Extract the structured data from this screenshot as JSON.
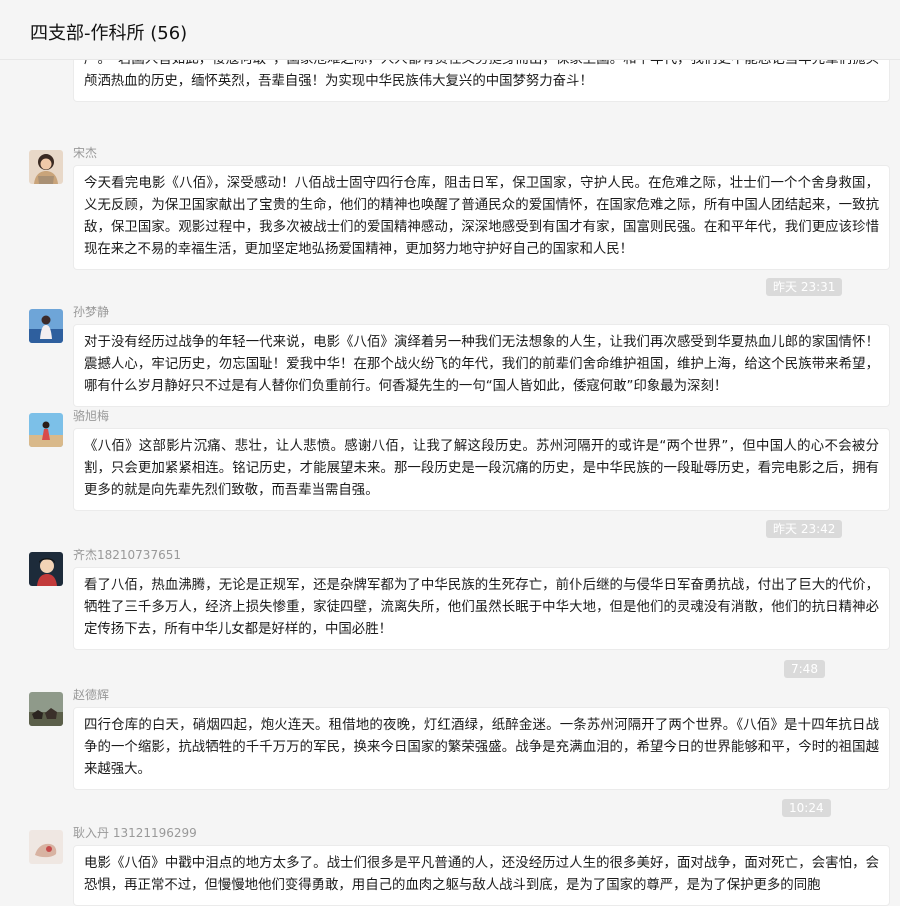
{
  "chat": {
    "title": "四支部-作科所 (56)"
  },
  "messages": [
    {
      "sender": "",
      "text": "在那些战火纷飞的年代，我观看了电影《八佰》。影片中的故事，壮烈热血主题，面对敌人的围剿进攻，八百名士兵们以一敌百，始终坚守着四行仓库，他们用身躯阻挡敌人的进攻，用生命升起旗帜，让世人看到中华儿女的自强不息，他们以血荐轩辕，捍卫了民族尊严。“若国人皆如此，倭寇何敢”，国家危难之际，人人都有责任义务挺身而出，保家卫国。和平年代，我们更不能忘记当年先辈们抛头颅洒热血的历史，缅怀英烈，吾辈自强！为实现中华民族伟大复兴的中国梦努力奋斗！"
    },
    {
      "sender": "宋杰",
      "text": "今天看完电影《八佰》，深受感动！八佰战士固守四行仓库，阻击日军，保卫国家，守护人民。在危难之际，壮士们一个个舍身救国，义无反顾，为保卫国家献出了宝贵的生命，他们的精神也唤醒了普通民众的爱国情怀，在国家危难之际，所有中国人团结起来，一致抗敌，保卫国家。观影过程中，我多次被战士们的爱国精神感动，深深地感受到有国才有家，国富则民强。在和平年代，我们更应该珍惜现在来之不易的幸福生活，更加坚定地弘扬爱国精神，更加努力地守护好自己的国家和人民！"
    },
    {
      "time": "昨天 23:31"
    },
    {
      "sender": "孙梦静",
      "text": "对于没有经历过战争的年轻一代来说，电影《八佰》演绎着另一种我们无法想象的人生，让我们再次感受到华夏热血儿郎的家国情怀！震撼人心，牢记历史，勿忘国耻！爱我中华！在那个战火纷飞的年代，我们的前辈们舍命维护祖国，维护上海，给这个民族带来希望，哪有什么岁月静好只不过是有人替你们负重前行。何香凝先生的一句“国人皆如此，倭寇何敢”印象最为深刻！"
    },
    {
      "sender": "骆旭梅",
      "text": "《八佰》这部影片沉痛、悲壮，让人悲愤。感谢八佰，让我了解这段历史。苏州河隔开的或许是“两个世界”，但中国人的心不会被分割，只会更加紧紧相连。铭记历史，才能展望未来。那一段历史是一段沉痛的历史，是中华民族的一段耻辱历史，看完电影之后，拥有更多的就是向先辈先烈们致敬，而吾辈当需自强。"
    },
    {
      "time": "昨天 23:42"
    },
    {
      "sender": "齐杰18210737651",
      "text": "看了八佰，热血沸腾，无论是正规军，还是杂牌军都为了中华民族的生死存亡，前仆后继的与侵华日军奋勇抗战，付出了巨大的代价，牺牲了三千多万人，经济上损失惨重，家徒四壁，流离失所，他们虽然长眠于中华大地，但是他们的灵魂没有消散，他们的抗日精神必定传扬下去，所有中华儿女都是好样的，中国必胜！"
    },
    {
      "time": "7:48"
    },
    {
      "sender": "赵德辉",
      "text": "四行仓库的白天，硝烟四起，炮火连天。租借地的夜晚，灯红酒绿，纸醉金迷。一条苏州河隔开了两个世界。《八佰》是十四年抗日战争的一个缩影，抗战牺牲的千千万万的军民，换来今日国家的繁荣强盛。战争是充满血泪的，希望今日的世界能够和平，今时的祖国越来越强大。"
    },
    {
      "time": "10:24"
    },
    {
      "sender": "耿入丹 13121196299",
      "text": "电影《八佰》中戳中泪点的地方太多了。战士们很多是平凡普通的人，还没经历过人生的很多美好，面对战争，面对死亡，会害怕，会恐惧，再正常不过，但慢慢地他们变得勇敢，用自己的血肉之躯与敌人战斗到底，是为了国家的尊严，是为了保护更多的同胞"
    }
  ]
}
